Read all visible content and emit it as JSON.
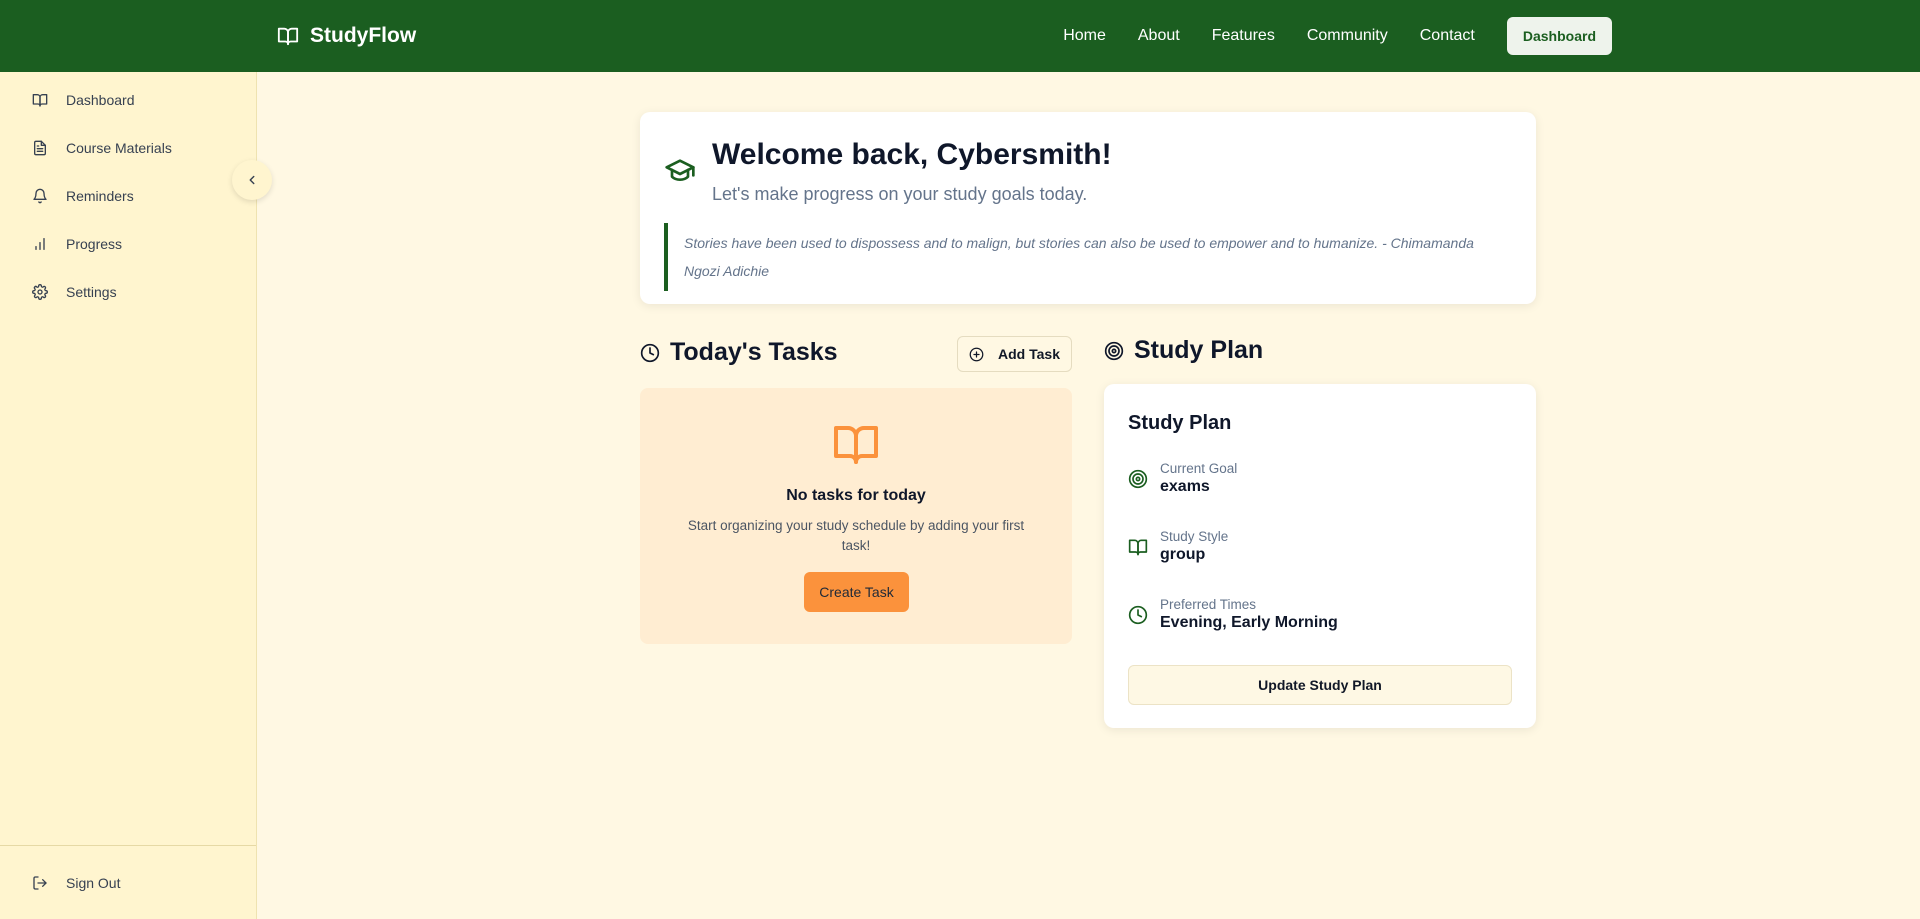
{
  "brand": {
    "name": "StudyFlow",
    "icon": "book-open-icon"
  },
  "nav": {
    "items": [
      "Home",
      "About",
      "Features",
      "Community",
      "Contact"
    ],
    "dashboard_label": "Dashboard"
  },
  "sidebar": {
    "items": [
      {
        "label": "Dashboard",
        "icon": "book-open-icon"
      },
      {
        "label": "Course Materials",
        "icon": "file-text-icon"
      },
      {
        "label": "Reminders",
        "icon": "bell-icon"
      },
      {
        "label": "Progress",
        "icon": "bar-chart-icon"
      },
      {
        "label": "Settings",
        "icon": "gear-icon"
      }
    ],
    "sign_out_label": "Sign Out",
    "collapse_icon": "chevron-left-icon"
  },
  "welcome": {
    "title": "Welcome back, Cybersmith!",
    "subtitle": "Let's make progress on your study goals today.",
    "quote": "Stories have been used to dispossess and to malign, but stories can also be used to empower and to humanize. - Chimamanda Ngozi Adichie"
  },
  "tasks": {
    "heading": "Today's Tasks",
    "add_label": "Add Task",
    "empty_title": "No tasks for today",
    "empty_message": "Start organizing your study schedule by adding your first task!",
    "create_label": "Create Task"
  },
  "study_plan": {
    "heading": "Study Plan",
    "card_title": "Study Plan",
    "rows": [
      {
        "label": "Current Goal",
        "value": "exams",
        "icon": "target-icon"
      },
      {
        "label": "Study Style",
        "value": "group",
        "icon": "book-open-icon"
      },
      {
        "label": "Preferred Times",
        "value": "Evening, Early Morning",
        "icon": "clock-icon"
      }
    ],
    "update_label": "Update Study Plan"
  },
  "colors": {
    "primary_green": "#1b5e20",
    "page_bg": "#fff8e3",
    "sidebar_bg": "#fff5cf",
    "accent_orange": "#fb923c",
    "tasks_bg": "#ffedd2"
  }
}
